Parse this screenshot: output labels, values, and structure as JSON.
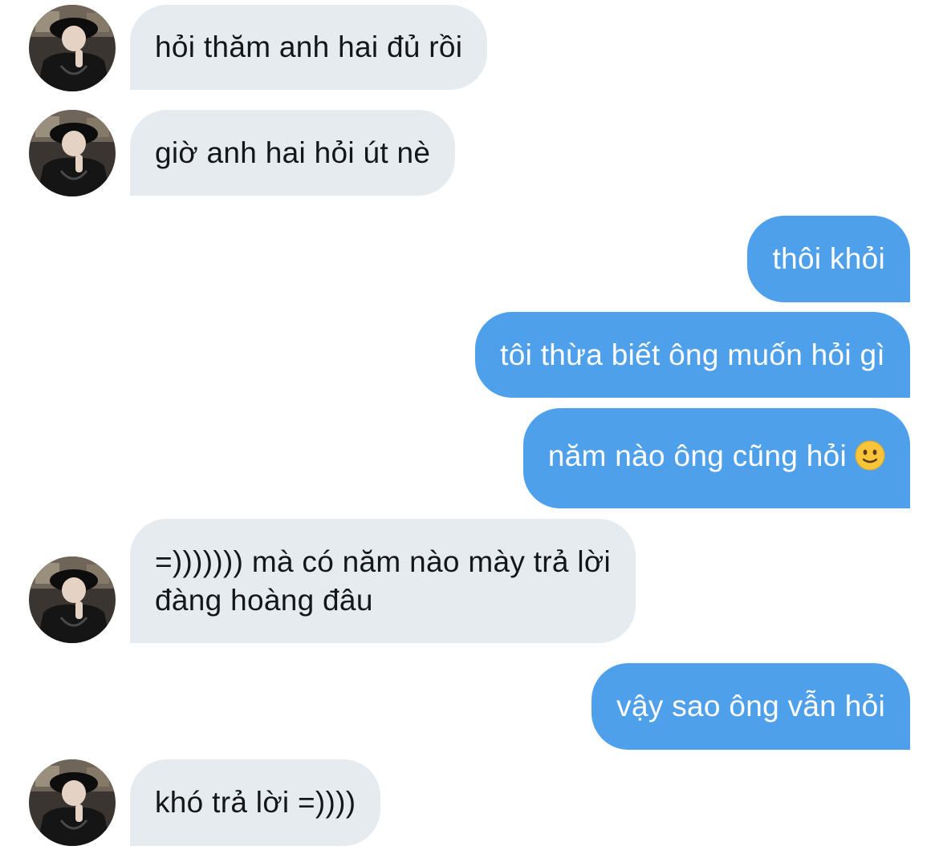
{
  "conversation": {
    "messages": [
      {
        "from": "them",
        "text": "hỏi thăm anh hai đủ rồi"
      },
      {
        "from": "them",
        "text": "giờ anh hai hỏi út nè"
      },
      {
        "from": "me",
        "text": "thôi khỏi"
      },
      {
        "from": "me",
        "text": "tôi thừa biết ông muốn hỏi gì"
      },
      {
        "from": "me",
        "text": "năm nào ông cũng hỏi",
        "emoji": "slightly-smiling-face-icon"
      },
      {
        "from": "them",
        "lines": [
          "=))))))) mà có năm nào mày trả lời",
          "đàng hoàng đâu"
        ]
      },
      {
        "from": "me",
        "text": "vậy sao ông vẫn hỏi"
      },
      {
        "from": "them",
        "text": "khó trả lời =))))"
      }
    ]
  },
  "colors": {
    "incoming_bubble": "#e6ebf0",
    "outgoing_bubble": "#4fa0eb",
    "incoming_text": "#14171a",
    "outgoing_text": "#ffffff",
    "background": "#ffffff"
  }
}
